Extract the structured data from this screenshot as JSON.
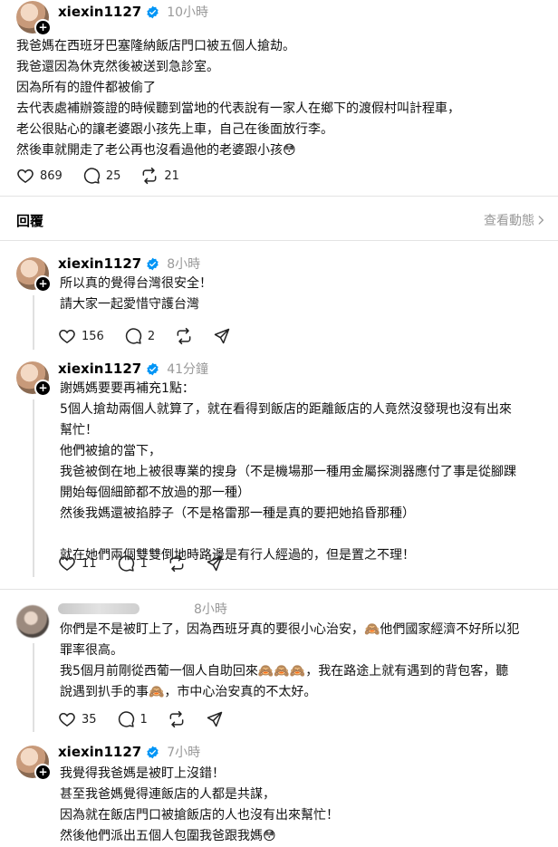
{
  "main_post": {
    "username": "xiexin1127",
    "time": "10小時",
    "text": "我爸媽在西班牙巴塞隆納飯店門口被五個人搶劫。\n我爸還因為休克然後被送到急診室。\n因為所有的證件都被偷了\n去代表處補辦簽證的時候聽到當地的代表說有一家人在鄉下的渡假村叫計程車，\n老公很貼心的讓老婆跟小孩先上車，自己在後面放行李。\n然後車就開走了老公再也沒看過他的老婆跟小孩😳",
    "likes": "869",
    "comments": "25",
    "reposts": "21"
  },
  "reply_bar": {
    "label": "回覆",
    "view_activity": "查看動態"
  },
  "replies": [
    {
      "username": "xiexin1127",
      "time": "8小時",
      "text": "所以真的覺得台灣很安全！\n請大家一起愛惜守護台灣",
      "likes": "156",
      "comments": "2"
    },
    {
      "username": "xiexin1127",
      "time": "41分鐘",
      "text": "謝媽媽要要再補充1點：\n5個人搶劫兩個人就算了，就在看得到飯店的距離飯店的人竟然沒發現也沒有出來\n幫忙！\n他們被搶的當下，\n我爸被倒在地上被很專業的搜身（不是機場那一種用金屬探測器應付了事是從腳踝\n開始每個細節都不放過的那一種）\n然後我媽還被掐脖子（不是格雷那一種是真的要把她掐昏那種）\n\n就在她們兩個雙雙倒地時路邊是有行人經過的，但是置之不理！",
      "likes": "11",
      "comments": "1"
    },
    {
      "time": "8小時",
      "text": "你們是不是被盯上了，因為西班牙真的要很小心治安，🙈他們國家經濟不好所以犯\n罪率很高。\n我5個月前剛從西葡一個人自助回來🙈🙈🙈，我在路途上就有遇到的背包客，聽\n說遇到扒手的事🙈，市中心治安真的不太好。",
      "likes": "35",
      "comments": "1"
    },
    {
      "username": "xiexin1127",
      "time": "7小時",
      "text": "我覺得我爸媽是被盯上沒錯！\n甚至我爸媽覺得連飯店的人都是共謀，\n因為就在飯店門口被搶飯店的人也沒有出來幫忙！\n然後他們派出五個人包圍我爸跟我媽😳"
    }
  ],
  "colors": {
    "verified": "#0095f6",
    "muted": "#999999",
    "separator": "#e3e3e3"
  },
  "icons": [
    "heart-icon",
    "comment-icon",
    "repost-icon",
    "share-icon",
    "verified-icon",
    "follow-plus-icon",
    "chevron-right-icon"
  ]
}
